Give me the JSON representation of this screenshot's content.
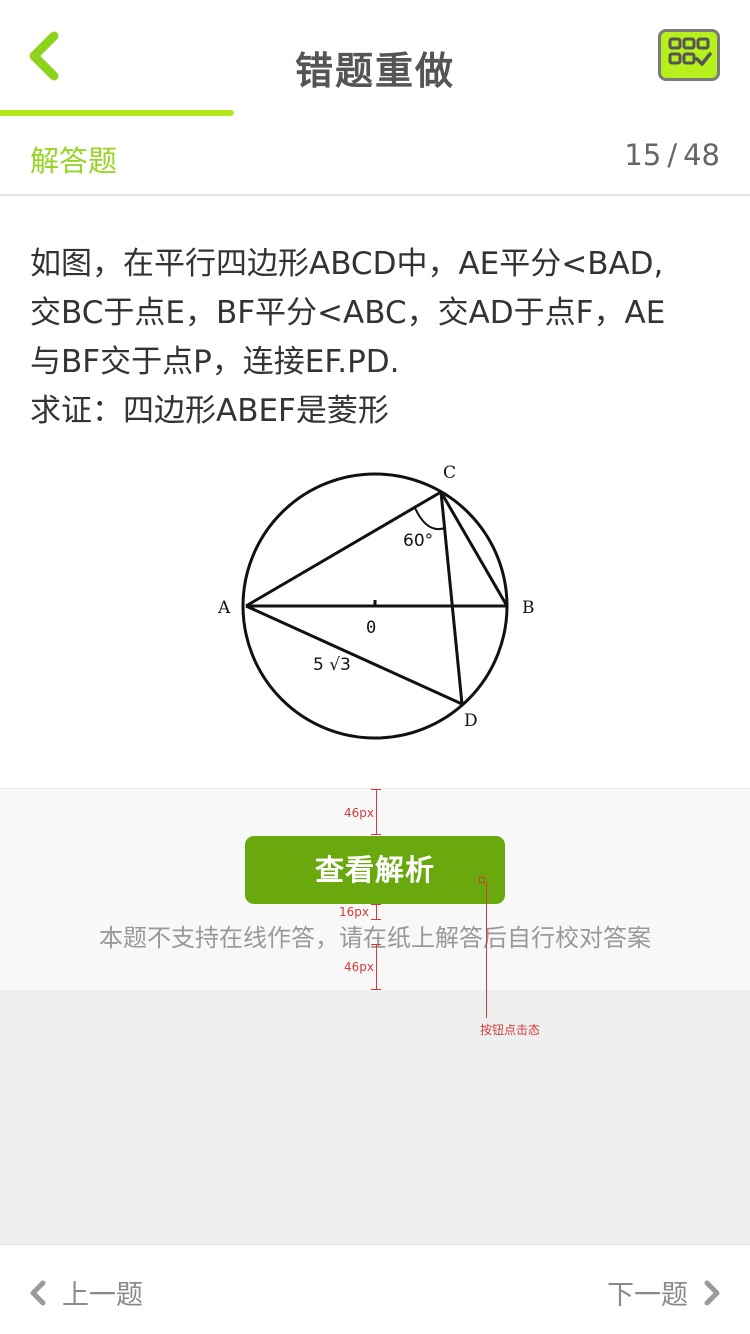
{
  "header": {
    "title": "错题重做",
    "progress": 0.3125
  },
  "typebar": {
    "type_label": "解答题",
    "current": "15",
    "separator": "/",
    "total": "48"
  },
  "question": {
    "lines": [
      "如图，在平行四边形ABCD中，AE平分<BAD,",
      "交BC于点E，BF平分<ABC，交AD于点F，AE",
      "与BF交于点P，连接EF.PD.",
      "求证：四边形ABEF是菱形"
    ],
    "figure": {
      "label_a": "A",
      "label_b": "B",
      "label_c": "C",
      "label_d": "D",
      "label_o": "0",
      "angle_label": "60°",
      "length_label": "5 √3"
    }
  },
  "action": {
    "analysis_button": "查看解析",
    "hint": "本题不支持在线作答，请在纸上解答后自行校对答案"
  },
  "annotations": {
    "top_gap": "46px",
    "mid_gap": "16px",
    "bottom_gap": "46px",
    "button_state_note": "按钮点击态"
  },
  "footer": {
    "prev_label": "上一题",
    "next_label": "下一题"
  },
  "colors": {
    "accent_green": "#97d525",
    "button_green": "#6aa90e",
    "card_icon_bg": "#b6f01c"
  }
}
